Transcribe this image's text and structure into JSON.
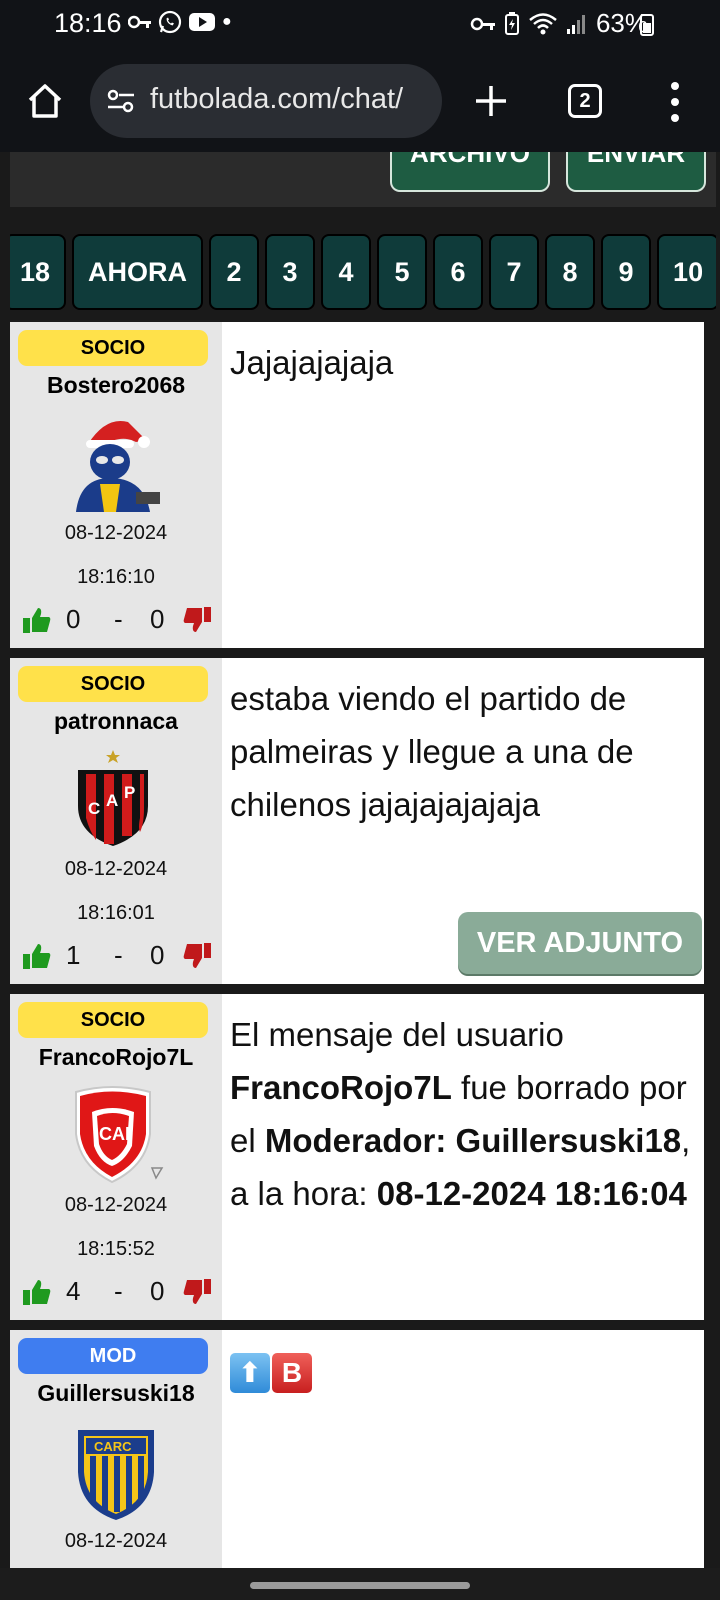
{
  "status_bar": {
    "time": "18:16",
    "battery": "63%"
  },
  "browser": {
    "url": "futbolada.com/chat/",
    "tab_count": "2"
  },
  "form": {
    "archivo_label": "ARCHIVO",
    "enviar_label": "ENVIAR"
  },
  "pagination": {
    "pages": [
      "18",
      "AHORA",
      "2",
      "3",
      "4",
      "5",
      "6",
      "7",
      "8",
      "9",
      "10"
    ]
  },
  "messages": [
    {
      "badge": "SOCIO",
      "username": "Bostero2068",
      "date": "08-12-2024",
      "time": "18:16:10",
      "likes": "0",
      "sep": "-",
      "dislikes": "0",
      "text": "Jajajajajaja"
    },
    {
      "badge": "SOCIO",
      "username": "patronnaca",
      "date": "08-12-2024",
      "time": "18:16:01",
      "likes": "1",
      "sep": "-",
      "dislikes": "0",
      "text": "estaba viendo el partido de palmeiras y llegue a una de chilenos jajajajajajaja",
      "attachment_label": "VER ADJUNTO"
    },
    {
      "badge": "SOCIO",
      "username": "FrancoRojo7L",
      "date": "08-12-2024",
      "time": "18:15:52",
      "likes": "4",
      "sep": "-",
      "dislikes": "0",
      "text_parts": {
        "p1": "El mensaje del usuario ",
        "user": "FrancoRojo7L",
        "p2": " fue borrado por el ",
        "mod_label": "Moderador: Guillersuski18",
        "p3": ", a la hora: ",
        "when": "08-12-2024 18:16:04"
      }
    },
    {
      "badge": "MOD",
      "username": "Guillersuski18",
      "date": "08-12-2024",
      "emoji_b": "B"
    }
  ],
  "colors": {
    "badge_socio": "#ffe14a",
    "badge_mod": "#3f7df0",
    "page_button": "#0f3b3a",
    "form_button": "#1e5c42",
    "thumb_up": "#1f9a1f",
    "thumb_down": "#c0191b"
  }
}
